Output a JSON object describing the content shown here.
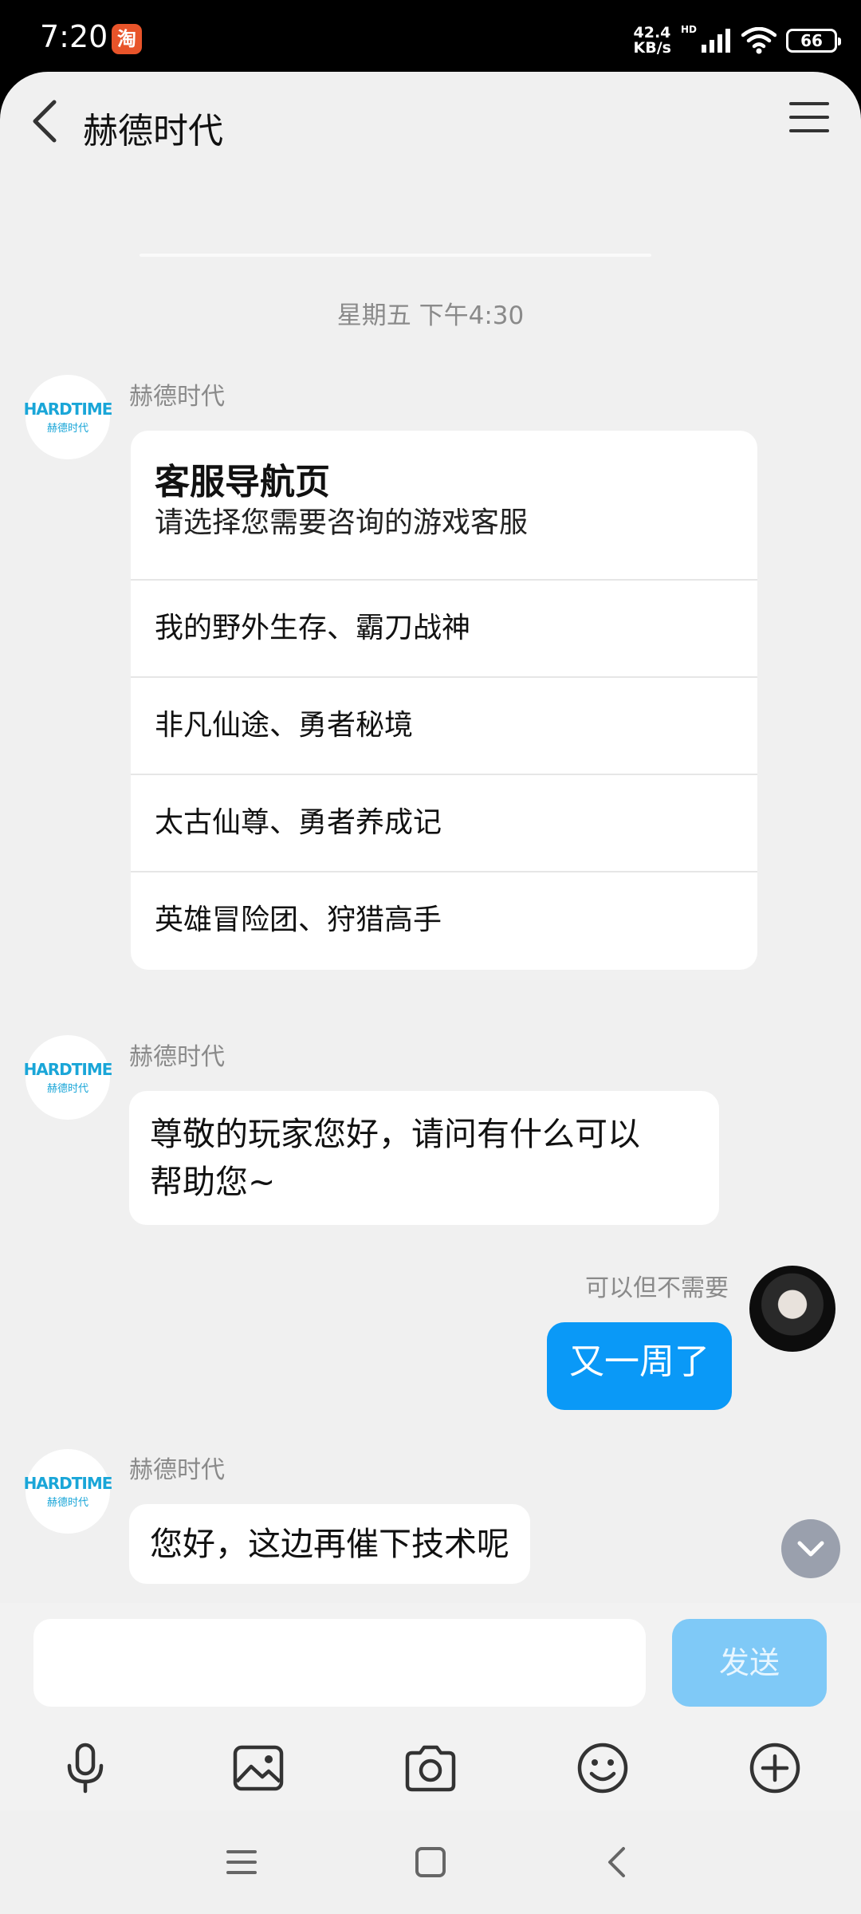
{
  "status_bar": {
    "time": "7:20",
    "app_badge": "淘",
    "speed_value": "42.4",
    "speed_unit": "KB/s",
    "network_label": "HD",
    "battery": "66"
  },
  "header": {
    "title": "赫德时代"
  },
  "chat": {
    "timestamp": "星期五 下午4:30",
    "brand_logo_en": "HARDTIME",
    "brand_logo_cn": "赫德时代",
    "messages": [
      {
        "sender": "赫德时代",
        "card_title": "客服导航页",
        "card_subtitle": "请选择您需要咨询的游戏客服",
        "options": [
          "我的野外生存、霸刀战神",
          "非凡仙途、勇者秘境",
          "太古仙尊、勇者养成记",
          "英雄冒险团、狩猎高手"
        ]
      },
      {
        "sender": "赫德时代",
        "line1": "尊敬的玩家您好，请问有什么可以",
        "line2": "帮助您~"
      },
      {
        "sender": "可以但不需要",
        "text": "又一周了"
      },
      {
        "sender": "赫德时代",
        "text": "您好，这边再催下技术呢"
      }
    ]
  },
  "input": {
    "value": "",
    "placeholder": "",
    "send_label": "发送"
  },
  "colors": {
    "accent": "#0a99f7",
    "send_disabled": "#7fc9f7",
    "brand": "#1aa6d8",
    "background": "#f0f0f0"
  },
  "icons": {
    "toolbar": [
      "microphone-icon",
      "image-icon",
      "camera-icon",
      "emoji-icon",
      "plus-icon"
    ],
    "nav": [
      "menu-icon",
      "home-icon",
      "back-icon"
    ]
  }
}
